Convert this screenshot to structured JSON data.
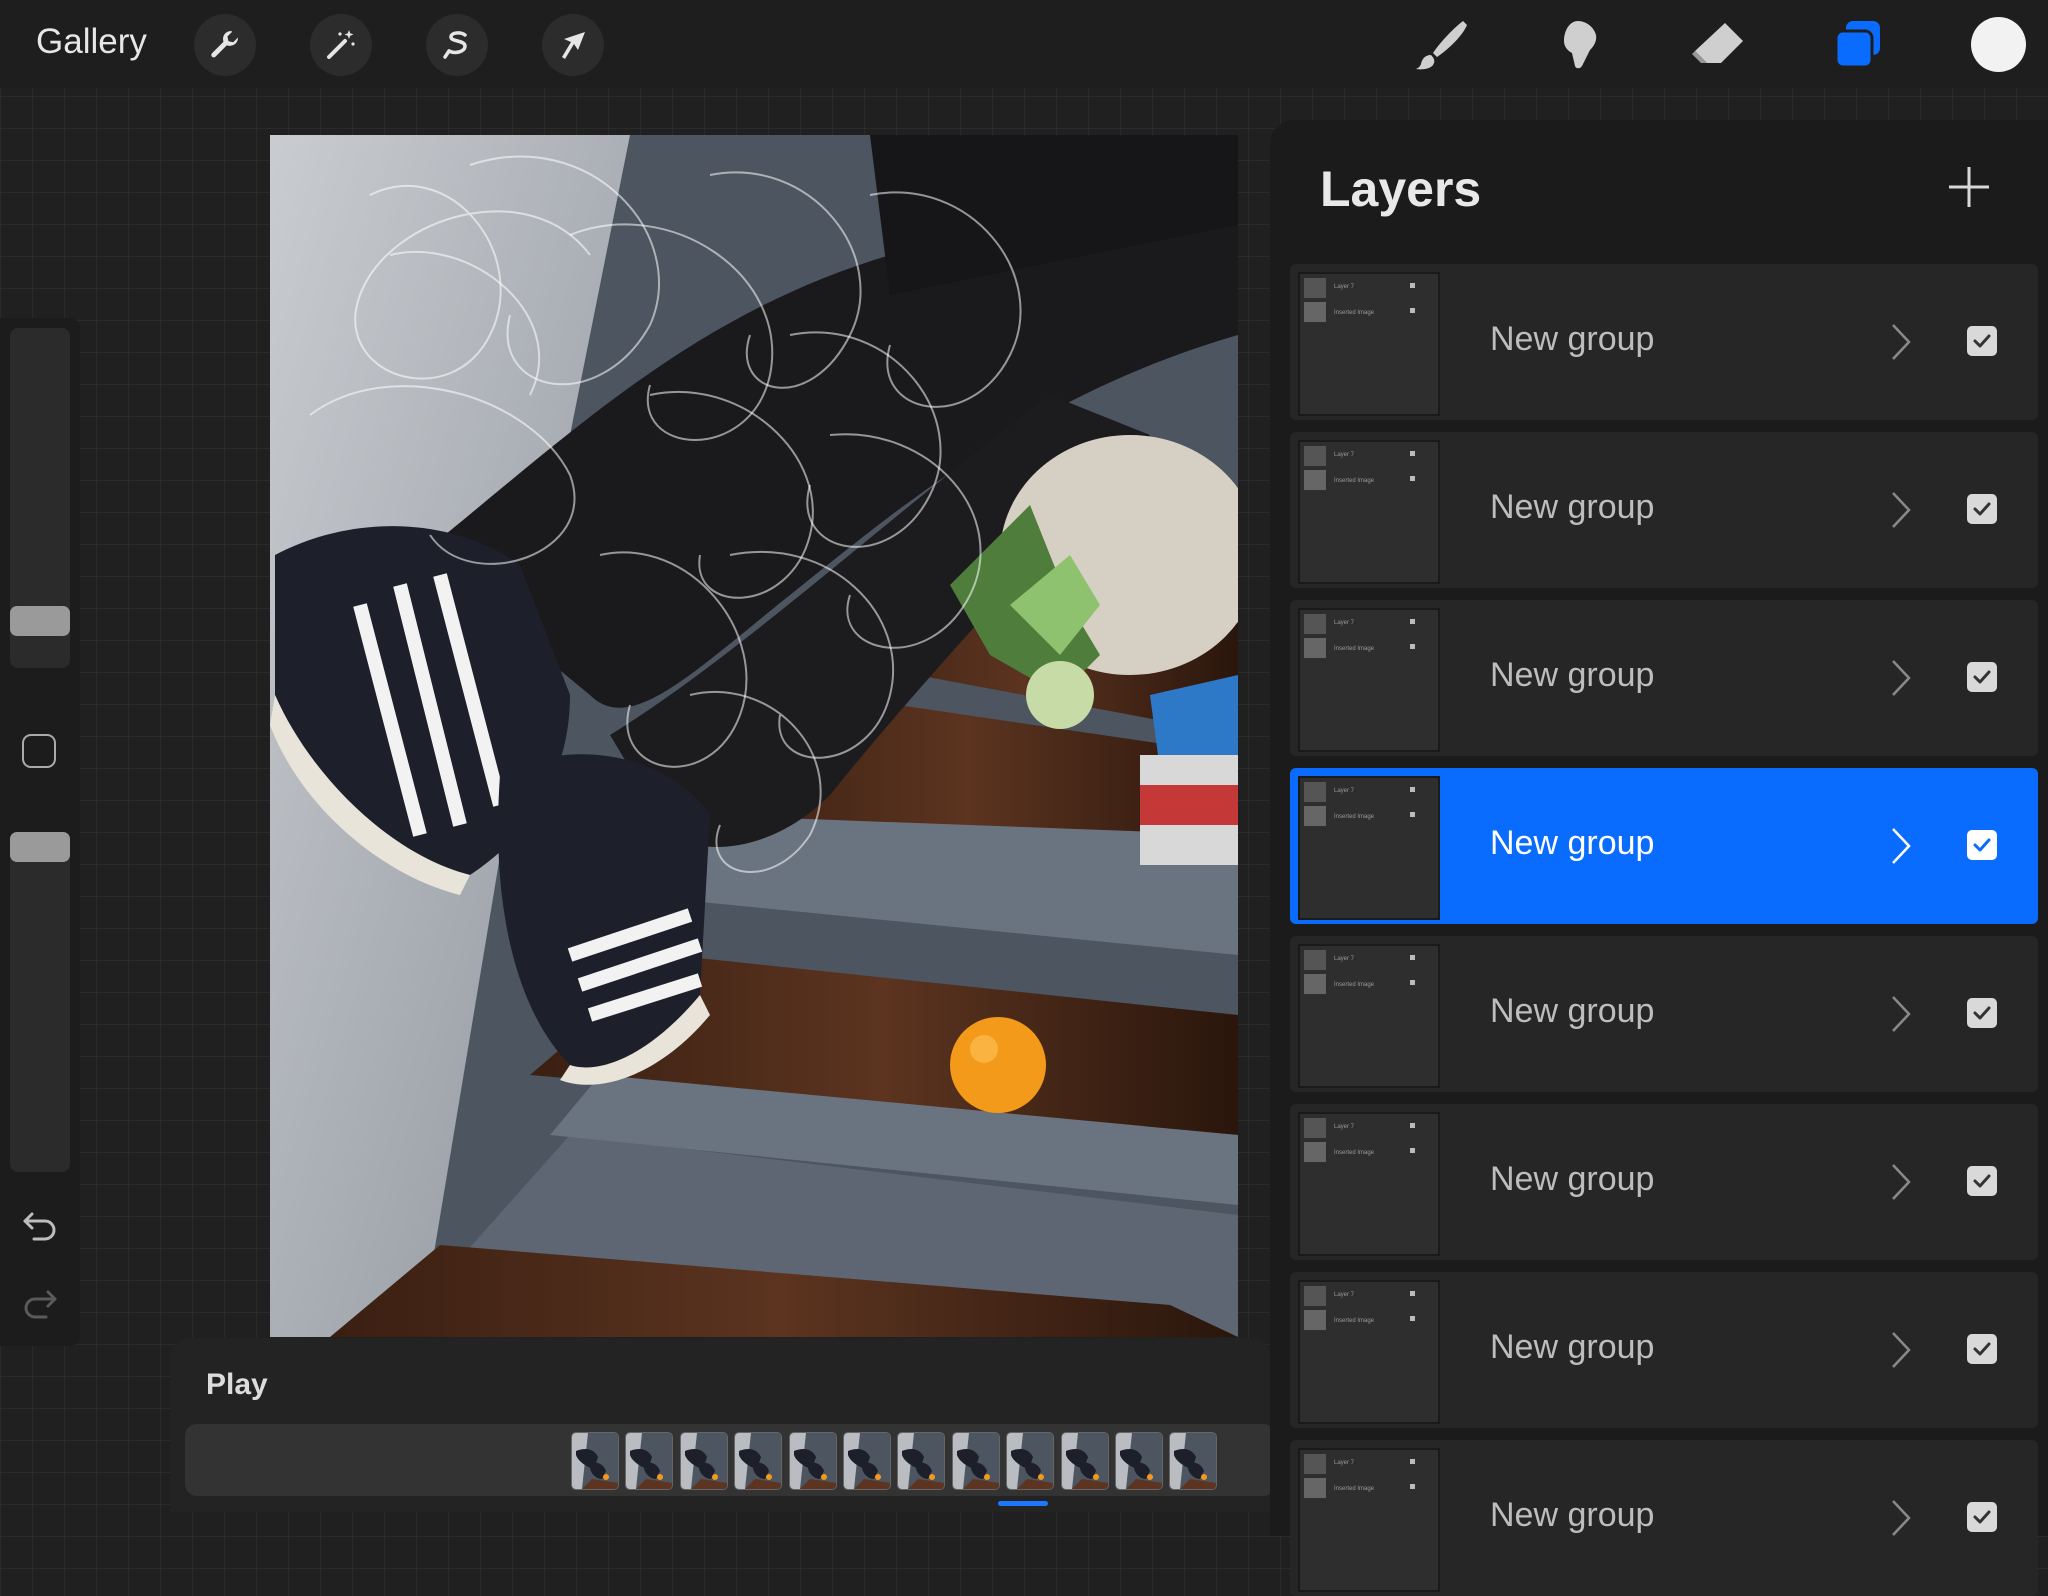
{
  "toolbar": {
    "gallery_label": "Gallery",
    "left_tools": [
      {
        "name": "actions",
        "icon": "wrench-icon"
      },
      {
        "name": "adjustments",
        "icon": "magic-wand-icon"
      },
      {
        "name": "selection",
        "icon": "selection-s-icon"
      },
      {
        "name": "transform",
        "icon": "arrow-cursor-icon"
      }
    ],
    "right_tools": [
      {
        "name": "brush",
        "icon": "brush-icon"
      },
      {
        "name": "smudge",
        "icon": "smudge-icon"
      },
      {
        "name": "eraser",
        "icon": "eraser-icon"
      },
      {
        "name": "layers",
        "icon": "layers-icon",
        "active": true
      }
    ],
    "current_color": "#f2f2f2",
    "accent": "#1e78ff"
  },
  "sidebar": {
    "brush_size_level": 0.09,
    "opacity_level": 1.0
  },
  "layers": {
    "title": "Layers",
    "items": [
      {
        "name": "New group",
        "visible": true,
        "selected": false,
        "thumb_line1": "Layer 7",
        "thumb_line2": "Inserted Image"
      },
      {
        "name": "New group",
        "visible": true,
        "selected": false,
        "thumb_line1": "Layer 7",
        "thumb_line2": "Inserted Image"
      },
      {
        "name": "New group",
        "visible": true,
        "selected": false,
        "thumb_line1": "Layer 7",
        "thumb_line2": "Inserted Image"
      },
      {
        "name": "New group",
        "visible": true,
        "selected": true,
        "thumb_line1": "Layer 7",
        "thumb_line2": "Inserted Image"
      },
      {
        "name": "New group",
        "visible": true,
        "selected": false,
        "thumb_line1": "Layer 7",
        "thumb_line2": "Inserted Image"
      },
      {
        "name": "New group",
        "visible": true,
        "selected": false,
        "thumb_line1": "Layer 7",
        "thumb_line2": "Inserted Image"
      },
      {
        "name": "New group",
        "visible": true,
        "selected": false,
        "thumb_line1": "Layer 7",
        "thumb_line2": "Inserted Image"
      },
      {
        "name": "New group",
        "visible": true,
        "selected": false,
        "thumb_line1": "Layer 7",
        "thumb_line2": "Inserted Image"
      }
    ]
  },
  "playback": {
    "label": "Play",
    "frame_count": 12
  }
}
